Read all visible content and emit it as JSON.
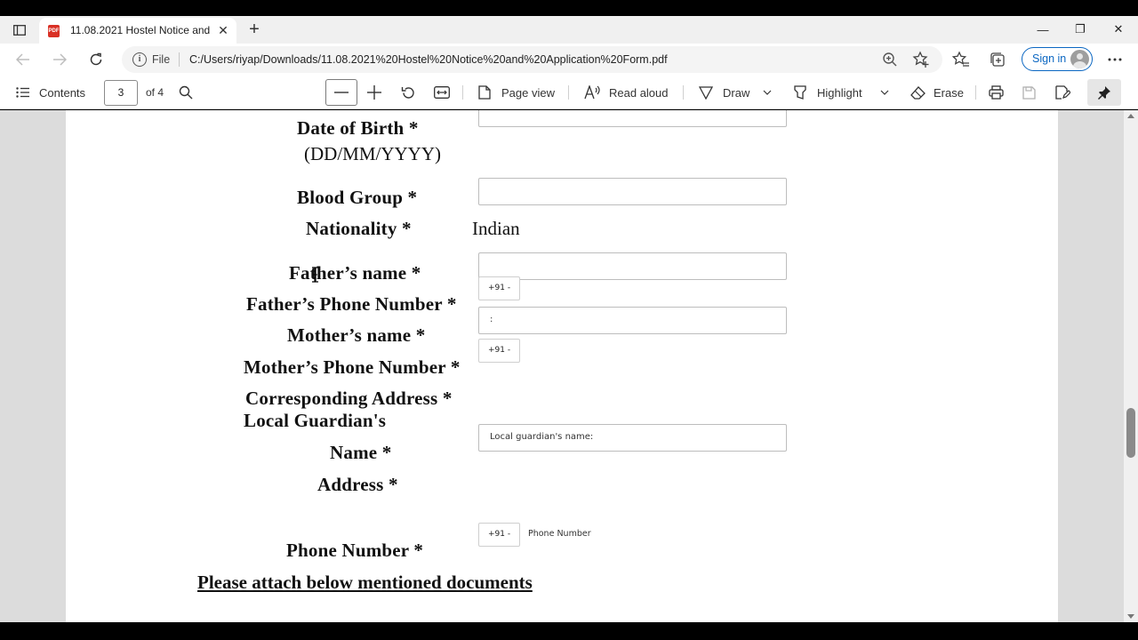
{
  "tab": {
    "title": "11.08.2021 Hostel Notice and Application Form.pdf",
    "favicon_text": "PDF"
  },
  "window": {
    "minimize": "—",
    "restore": "❐",
    "close": "✕"
  },
  "address_bar": {
    "scheme": "File",
    "url": "C:/Users/riyap/Downloads/11.08.2021%20Hostel%20Notice%20and%20Application%20Form.pdf",
    "signin_label": "Sign in"
  },
  "pdf_toolbar": {
    "contents_label": "Contents",
    "page_current": "3",
    "page_total": "of 4",
    "page_view_label": "Page view",
    "read_aloud_label": "Read aloud",
    "draw_label": "Draw",
    "highlight_label": "Highlight",
    "erase_label": "Erase"
  },
  "form": {
    "dob_label": "Date of Birth *",
    "dob_format": "(DD/MM/YYYY)",
    "blood_group_label": "Blood Group *",
    "nationality_label": "Nationality *",
    "nationality_value": "Indian",
    "father_name_label": "Father’s name *",
    "father_phone_label": "Father’s Phone Number *",
    "father_phone_prefix": "+91 -",
    "mother_name_label": "Mother’s name *",
    "mother_name_value": ":",
    "mother_phone_label": "Mother’s Phone Number *",
    "mother_phone_prefix": "+91 -",
    "address_label": "Corresponding Address *",
    "local_guardian_label": "Local Guardian's",
    "guardian_name_label": "Name *",
    "guardian_name_placeholder": "Local guardian's name:",
    "guardian_address_label": "Address *",
    "guardian_phone_label": "Phone Number *",
    "guardian_phone_prefix": "+91 -",
    "guardian_phone_hint": "Phone Number",
    "documents_heading": "Please attach below mentioned documents"
  },
  "colors": {
    "accent": "#0b67c2",
    "pdf_favicon": "#d93025",
    "viewport_bg": "#dcdcdc"
  }
}
